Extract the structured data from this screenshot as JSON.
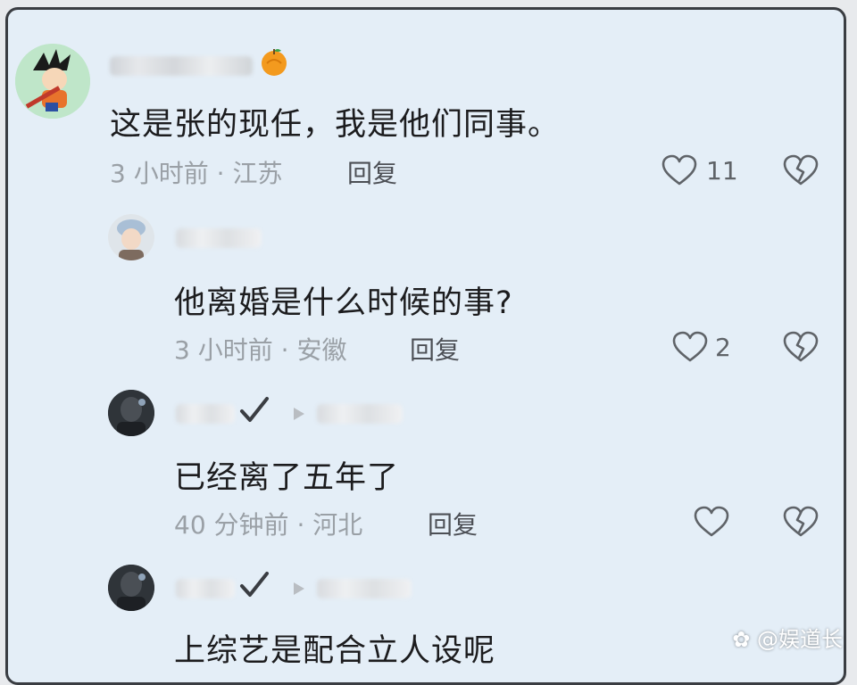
{
  "comments": [
    {
      "text": "这是张的现任，我是他们同事。",
      "time": "3 小时前",
      "location": "江苏",
      "reply_label": "回复",
      "likes": "11",
      "badge_icon": "orange-fruit-icon"
    },
    {
      "text": "他离婚是什么时候的事?",
      "time": "3 小时前",
      "location": "安徽",
      "reply_label": "回复",
      "likes": "2"
    },
    {
      "text": "已经离了五年了",
      "time": "40 分钟前",
      "location": "河北",
      "reply_label": "回复",
      "likes": ""
    },
    {
      "text": "上综艺是配合立人设呢"
    }
  ],
  "separator": "·",
  "watermark": "@娱道长",
  "colors": {
    "background": "#e4eef7",
    "frame_border": "#3a3d42",
    "text_primary": "#1c1c1e",
    "text_meta": "#9aa0a6",
    "icon": "#5f6368"
  }
}
